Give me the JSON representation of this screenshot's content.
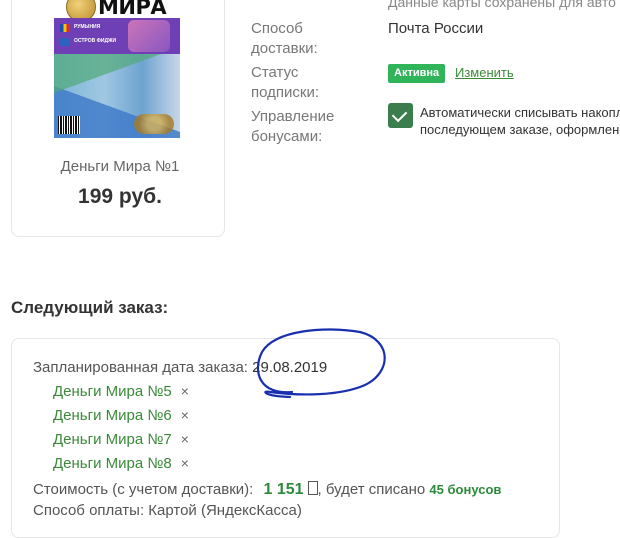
{
  "product": {
    "cover_title": "МИРА",
    "cover_band_line1": "РУМЫНИЯ",
    "cover_band_line2": "ОСТРОВ ФИДЖИ",
    "name": "Деньги Мира №1",
    "price": "199 руб."
  },
  "subscription": {
    "card_saved_note": "Данные карты сохранены для авто",
    "delivery_label_line1": "Способ",
    "delivery_label_line2": "доставки:",
    "delivery_value": "Почта России",
    "status_label_line1": "Статус",
    "status_label_line2": "подписки:",
    "status_badge": "Активна",
    "change_link": "Изменить",
    "bonus_label_line1": "Управление",
    "bonus_label_line2": "бонусами:",
    "bonus_text_line1": "Автоматически списывать накопл",
    "bonus_text_line2": "последующем заказе, оформленн",
    "bonus_checked": true
  },
  "next_order": {
    "heading": "Следующий заказ:",
    "date_label": "Запланированная дата заказа:",
    "date_value": "29.08.2019",
    "items": [
      {
        "name": "Деньги Мира №5",
        "remove": "×"
      },
      {
        "name": "Деньги Мира №6",
        "remove": "×"
      },
      {
        "name": "Деньги Мира №7",
        "remove": "×"
      },
      {
        "name": "Деньги Мира №8",
        "remove": "×"
      }
    ],
    "cost_label": "Стоимость (с учетом доставки):",
    "cost_amount": "1 151",
    "cost_suffix": ", будет списано",
    "bonus_amount": "45 бонусов",
    "payment_label": "Способ оплаты:",
    "payment_value": "Картой (ЯндексКасса)"
  },
  "colors": {
    "green_link": "#3a8a3a",
    "badge_bg": "#2fb45a",
    "checkbox_bg": "#3c7d4e",
    "scribble": "#1a2fb0"
  }
}
